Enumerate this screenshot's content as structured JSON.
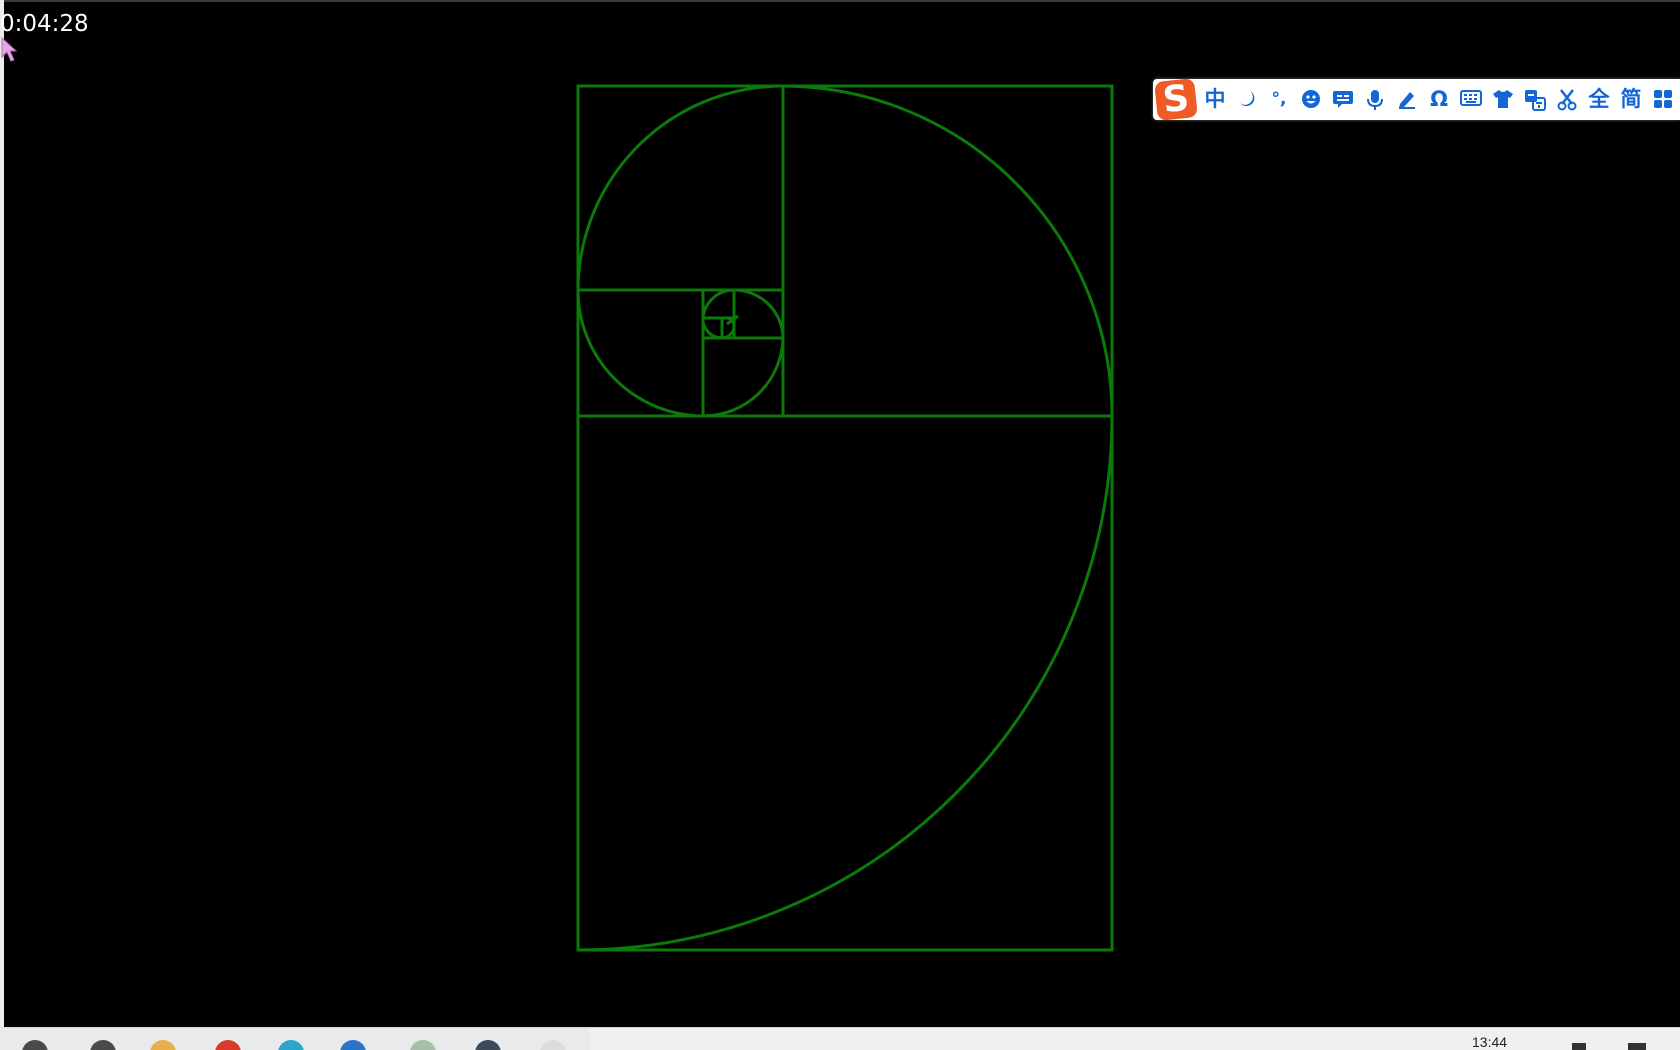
{
  "timer": {
    "text": "0:04:28"
  },
  "drawing": {
    "stroke_color": "#0b7a0b",
    "background": "#000000",
    "description_shape": "golden-spiral"
  },
  "ime_toolbar": {
    "logo": "S",
    "items": [
      {
        "label": "中",
        "icon": "chinese-mode-icon"
      },
      {
        "label": "",
        "icon": "moon-punctuation-icon"
      },
      {
        "label": "°,",
        "icon": "punctuation-icon"
      },
      {
        "label": "",
        "icon": "emoji-icon"
      },
      {
        "label": "",
        "icon": "voice-input-box-icon"
      },
      {
        "label": "",
        "icon": "microphone-icon"
      },
      {
        "label": "",
        "icon": "handwriting-pen-icon"
      },
      {
        "label": "Ω",
        "icon": "symbol-omega-icon"
      },
      {
        "label": "",
        "icon": "keyboard-icon"
      },
      {
        "label": "",
        "icon": "skin-shirt-icon"
      },
      {
        "label": "",
        "icon": "translate-icon"
      },
      {
        "label": "",
        "icon": "scissors-icon"
      },
      {
        "label": "全",
        "icon": "fullwidth-icon"
      },
      {
        "label": "简",
        "icon": "simplified-icon"
      },
      {
        "label": "",
        "icon": "grid-menu-icon"
      }
    ],
    "accent_color": "#1266d6",
    "logo_color": "#ef5a26"
  },
  "taskbar": {
    "clock": "13:44",
    "icons": [
      "start-icon",
      "search-icon",
      "file-explorer-icon",
      "chrome-icon",
      "edge-icon",
      "mail-icon",
      "notepad-icon",
      "app-window-icon",
      "document-icon"
    ],
    "icon_colors": [
      "#4a4a4a",
      "#4a4a4a",
      "#e8b04a",
      "#d93a2b",
      "#2aa6c9",
      "#2a73c9",
      "#a6c0a6",
      "#3c4a5c",
      "#dcdcdc"
    ]
  }
}
